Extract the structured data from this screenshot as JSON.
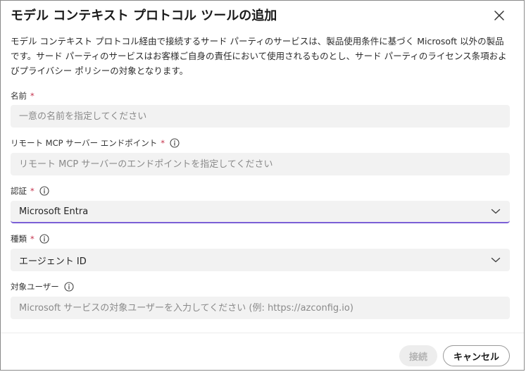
{
  "dialog": {
    "title": "モデル コンテキスト プロトコル ツールの追加",
    "description": "モデル コンテキスト プロトコル経由で接続するサード パーティのサービスは、製品使用条件に基づく Microsoft 以外の製品です。サード パーティのサービスはお客様ご自身の責任において使用されるものとし、サード パーティのライセンス条項およびプライバシー ポリシーの対象となります。"
  },
  "form": {
    "name": {
      "label": "名前",
      "required": "*",
      "placeholder": "一意の名前を指定してください"
    },
    "endpoint": {
      "label": "リモート MCP サーバー エンドポイント",
      "required": "*",
      "placeholder": "リモート MCP サーバーのエンドポイントを指定してください"
    },
    "auth": {
      "label": "認証",
      "required": "*",
      "value": "Microsoft Entra"
    },
    "type": {
      "label": "種類",
      "required": "*",
      "value": "エージェント ID"
    },
    "audience": {
      "label": "対象ユーザー",
      "placeholder": "Microsoft サービスの対象ユーザーを入力してください (例: https://azconfig.io)"
    }
  },
  "footer": {
    "connect_label": "接続",
    "cancel_label": "キャンセル"
  },
  "colors": {
    "required": "#c4314b",
    "focus_accent": "#7b5fd6",
    "field_bg": "#f2f2f2"
  },
  "icons": {
    "close": "close-icon",
    "info": "info-icon",
    "chevron": "chevron-down-icon"
  }
}
